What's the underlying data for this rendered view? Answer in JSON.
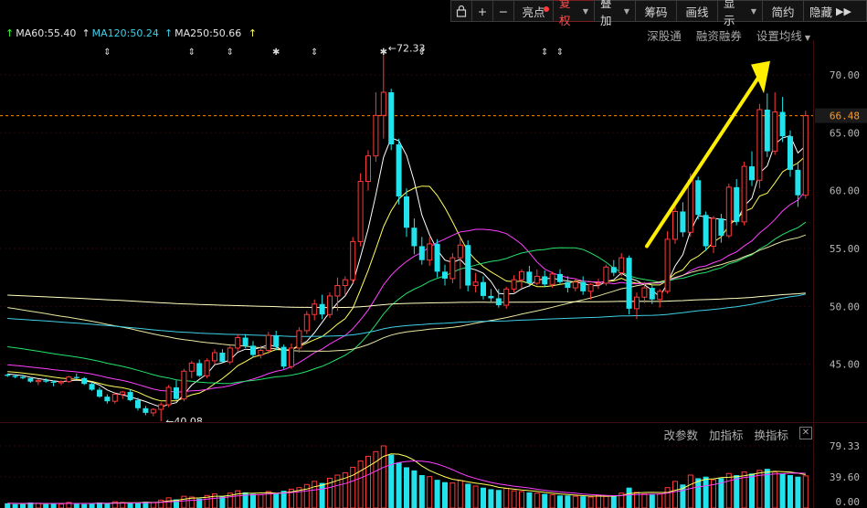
{
  "toolbar": {
    "lock_icon": "lock-icon",
    "zoom_in": "+",
    "zoom_out": "−",
    "highlight": "亮点",
    "restore_rights": "复权",
    "overlay": "叠加",
    "chips": "筹码",
    "draw_line": "画线",
    "display": "显示",
    "simple": "简约",
    "hide": "隐藏",
    "expand_icon": "double-chevron-right-icon"
  },
  "ma_legend": [
    {
      "label": "MA60:55.40",
      "color": "#ffffff"
    },
    {
      "label": "MA120:50.24",
      "color": "#3fd0e8"
    },
    {
      "label": "MA250:50.66",
      "color": "#ffff5a"
    }
  ],
  "top_links": {
    "shenzhen_connect": "深股通",
    "margin_trading": "融资融券",
    "set_ma": "设置均线"
  },
  "volume_tools": {
    "change_params": "改参数",
    "add_indicator": "加指标",
    "switch_indicator": "换指标",
    "close": "✕"
  },
  "colors": {
    "up": "#ff3a3a",
    "down": "#22e3ec",
    "ma5": "#ffffff",
    "ma10": "#ffff5a",
    "ma20": "#ff40ff",
    "ma30": "#22e36b",
    "ma60": "#e8e8a0",
    "ma120": "#3fd0e8",
    "ma250": "#ffffc0",
    "current_line": "#ff8a00",
    "arrow": "#ffee00"
  },
  "chart_data": [
    {
      "type": "candlestick",
      "y_ticks": [
        "70.00",
        "65.00",
        "60.00",
        "55.00",
        "50.00",
        "45.00"
      ],
      "ylim": [
        40,
        73
      ],
      "current_price": "66.48",
      "max_marker": "72.33",
      "min_marker": "40.08",
      "candles": [
        [
          44.1,
          44.2,
          43.9,
          44.0
        ],
        [
          44.0,
          44.1,
          43.8,
          43.9
        ],
        [
          43.9,
          44.1,
          43.7,
          43.8
        ],
        [
          43.8,
          43.9,
          43.4,
          43.5
        ],
        [
          43.5,
          43.7,
          43.2,
          43.6
        ],
        [
          43.6,
          43.8,
          43.4,
          43.5
        ],
        [
          43.5,
          43.6,
          43.1,
          43.4
        ],
        [
          43.4,
          43.6,
          43.2,
          43.5
        ],
        [
          43.5,
          44.0,
          43.4,
          43.9
        ],
        [
          43.9,
          44.2,
          43.7,
          43.8
        ],
        [
          43.8,
          43.9,
          43.2,
          43.3
        ],
        [
          43.3,
          43.4,
          42.7,
          42.8
        ],
        [
          42.8,
          43.0,
          42.1,
          42.2
        ],
        [
          42.2,
          42.4,
          41.6,
          41.8
        ],
        [
          41.8,
          42.6,
          41.6,
          42.4
        ],
        [
          42.4,
          42.7,
          42.0,
          42.6
        ],
        [
          42.6,
          42.8,
          41.8,
          41.9
        ],
        [
          41.9,
          42.1,
          41.0,
          41.2
        ],
        [
          41.2,
          41.4,
          40.6,
          40.8
        ],
        [
          40.8,
          41.2,
          40.5,
          41.1
        ],
        [
          41.1,
          41.7,
          40.08,
          41.5
        ],
        [
          41.5,
          43.2,
          41.3,
          43.0
        ],
        [
          43.0,
          43.6,
          41.9,
          42.0
        ],
        [
          42.0,
          44.6,
          41.8,
          44.4
        ],
        [
          44.4,
          45.3,
          43.8,
          45.1
        ],
        [
          45.1,
          45.4,
          43.9,
          44.0
        ],
        [
          44.0,
          45.5,
          43.8,
          45.3
        ],
        [
          45.3,
          46.3,
          45.0,
          46.0
        ],
        [
          46.0,
          46.3,
          45.1,
          45.2
        ],
        [
          45.2,
          46.6,
          45.0,
          46.4
        ],
        [
          46.4,
          47.6,
          46.1,
          47.3
        ],
        [
          47.3,
          47.6,
          46.4,
          46.6
        ],
        [
          46.6,
          47.0,
          45.6,
          45.8
        ],
        [
          45.8,
          46.6,
          45.5,
          46.2
        ],
        [
          46.2,
          47.8,
          45.9,
          47.5
        ],
        [
          47.5,
          47.9,
          46.2,
          46.5
        ],
        [
          46.5,
          46.7,
          44.6,
          44.8
        ],
        [
          44.8,
          46.8,
          44.6,
          46.4
        ],
        [
          46.4,
          48.2,
          46.0,
          47.9
        ],
        [
          47.9,
          49.6,
          47.6,
          49.3
        ],
        [
          49.3,
          50.6,
          48.8,
          50.2
        ],
        [
          50.2,
          51.0,
          48.9,
          49.3
        ],
        [
          49.3,
          51.2,
          49.0,
          50.9
        ],
        [
          50.9,
          52.5,
          49.6,
          51.8
        ],
        [
          51.8,
          52.6,
          51.0,
          52.3
        ],
        [
          52.3,
          56.0,
          52.0,
          55.6
        ],
        [
          55.6,
          61.5,
          55.2,
          60.8
        ],
        [
          60.8,
          63.5,
          60.0,
          63.0
        ],
        [
          63.0,
          68.5,
          62.5,
          66.5
        ],
        [
          66.5,
          72.33,
          64.5,
          68.5
        ],
        [
          68.5,
          68.8,
          63.5,
          64.0
        ],
        [
          64.0,
          64.5,
          58.8,
          59.5
        ],
        [
          59.5,
          60.2,
          56.0,
          56.8
        ],
        [
          56.8,
          57.6,
          54.5,
          55.2
        ],
        [
          55.2,
          56.0,
          53.6,
          54.0
        ],
        [
          54.0,
          56.0,
          53.5,
          55.4
        ],
        [
          55.4,
          55.8,
          52.5,
          53.0
        ],
        [
          53.0,
          53.6,
          51.8,
          52.4
        ],
        [
          52.4,
          54.6,
          52.0,
          54.2
        ],
        [
          54.2,
          55.9,
          51.5,
          55.3
        ],
        [
          55.3,
          55.7,
          51.3,
          51.8
        ],
        [
          51.8,
          52.9,
          51.2,
          52.1
        ],
        [
          52.1,
          52.6,
          50.6,
          50.9
        ],
        [
          50.9,
          51.5,
          50.3,
          50.7
        ],
        [
          50.7,
          51.5,
          49.9,
          50.1
        ],
        [
          50.1,
          51.7,
          49.8,
          51.5
        ],
        [
          51.5,
          52.7,
          51.2,
          52.3
        ],
        [
          52.3,
          53.2,
          51.6,
          53.0
        ],
        [
          53.0,
          53.5,
          51.7,
          52.0
        ],
        [
          52.0,
          53.2,
          51.8,
          52.6
        ],
        [
          52.6,
          53.1,
          51.7,
          51.9
        ],
        [
          51.9,
          53.0,
          51.6,
          52.8
        ],
        [
          52.8,
          53.2,
          51.9,
          52.1
        ],
        [
          52.1,
          52.6,
          51.2,
          51.6
        ],
        [
          51.6,
          52.4,
          51.3,
          52.1
        ],
        [
          52.1,
          52.6,
          51.0,
          51.3
        ],
        [
          51.3,
          52.0,
          50.6,
          51.9
        ],
        [
          51.9,
          52.4,
          51.5,
          52.0
        ],
        [
          52.0,
          53.6,
          51.8,
          53.4
        ],
        [
          53.4,
          54.0,
          52.6,
          52.9
        ],
        [
          52.9,
          54.6,
          52.6,
          54.2
        ],
        [
          54.2,
          54.4,
          49.3,
          49.8
        ],
        [
          49.8,
          51.2,
          48.9,
          50.8
        ],
        [
          50.8,
          52.1,
          50.3,
          51.6
        ],
        [
          51.6,
          51.9,
          50.2,
          50.6
        ],
        [
          50.6,
          51.5,
          49.9,
          51.3
        ],
        [
          51.3,
          56.5,
          51.1,
          55.8
        ],
        [
          55.8,
          58.6,
          55.4,
          58.2
        ],
        [
          58.2,
          59.0,
          56.0,
          56.4
        ],
        [
          56.4,
          61.5,
          56.0,
          60.9
        ],
        [
          60.9,
          61.2,
          57.5,
          57.9
        ],
        [
          57.9,
          58.2,
          54.8,
          55.2
        ],
        [
          55.2,
          57.8,
          54.6,
          57.6
        ],
        [
          57.6,
          58.0,
          55.5,
          56.1
        ],
        [
          56.1,
          60.6,
          55.9,
          60.3
        ],
        [
          60.3,
          61.0,
          57.0,
          57.3
        ],
        [
          57.3,
          62.5,
          57.0,
          62.1
        ],
        [
          62.1,
          63.4,
          60.4,
          60.9
        ],
        [
          60.9,
          67.5,
          60.2,
          67.0
        ],
        [
          67.0,
          68.4,
          62.9,
          63.4
        ],
        [
          63.4,
          68.5,
          63.1,
          66.8
        ],
        [
          66.8,
          68.1,
          64.2,
          64.7
        ],
        [
          64.7,
          65.2,
          61.2,
          61.8
        ],
        [
          61.8,
          62.5,
          58.6,
          59.6
        ],
        [
          59.6,
          66.9,
          59.3,
          66.48
        ]
      ],
      "volumes": [
        6,
        5,
        5,
        7,
        6,
        5,
        6,
        5,
        7,
        6,
        5,
        6,
        7,
        6,
        8,
        7,
        6,
        7,
        8,
        7,
        10,
        13,
        11,
        15,
        14,
        12,
        16,
        18,
        15,
        19,
        22,
        20,
        18,
        17,
        21,
        19,
        22,
        24,
        26,
        30,
        34,
        32,
        38,
        42,
        45,
        52,
        60,
        66,
        72,
        79.33,
        68,
        58,
        52,
        48,
        42,
        40,
        36,
        33,
        32,
        35,
        31,
        28,
        26,
        24,
        23,
        25,
        22,
        21,
        20,
        19,
        18,
        17,
        16,
        16,
        15,
        15,
        14,
        16,
        15,
        16,
        19,
        26,
        20,
        18,
        17,
        18,
        26,
        34,
        30,
        42,
        38,
        40,
        36,
        38,
        44,
        42,
        46,
        44,
        48,
        50,
        46,
        44,
        42,
        40,
        41
      ],
      "vol_ticks": [
        "79.33",
        "39.60",
        "0.00"
      ]
    }
  ]
}
